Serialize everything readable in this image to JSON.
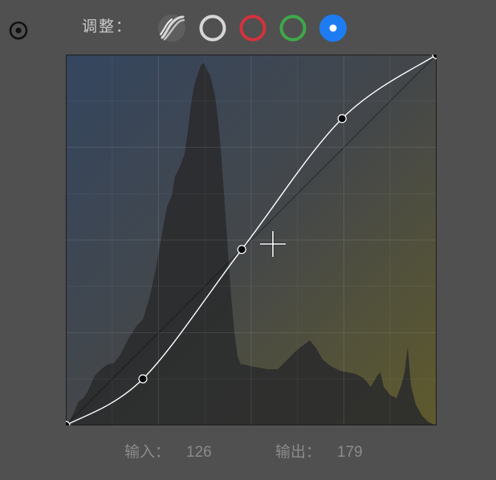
{
  "toolbar": {
    "adjust_label": "调整：",
    "channels": [
      {
        "name": "parametric",
        "icon": "parametric-curve-icon"
      },
      {
        "name": "rgb",
        "icon": "rgb-channel-icon",
        "color": "#d6d6d6"
      },
      {
        "name": "red",
        "icon": "red-channel-icon",
        "color": "#d3323c"
      },
      {
        "name": "green",
        "icon": "green-channel-icon",
        "color": "#3ea84a"
      },
      {
        "name": "blue",
        "icon": "blue-channel-icon",
        "color": "#1d7cf2",
        "selected": true
      }
    ]
  },
  "curve": {
    "points": [
      [
        0,
        0
      ],
      [
        53,
        32
      ],
      [
        121,
        121
      ],
      [
        190,
        211
      ],
      [
        255,
        255
      ]
    ],
    "selected_point_index": 2
  },
  "readout": {
    "input_label": "输入：",
    "input_value": "126",
    "output_label": "输出：",
    "output_value": "179"
  },
  "colors": {
    "panel_bg": "#505050",
    "gradient_top_left": "#34465f",
    "gradient_bottom_right": "#5f5a2c",
    "curve_line": "#ffffff",
    "accent_blue": "#1d7cf2"
  }
}
